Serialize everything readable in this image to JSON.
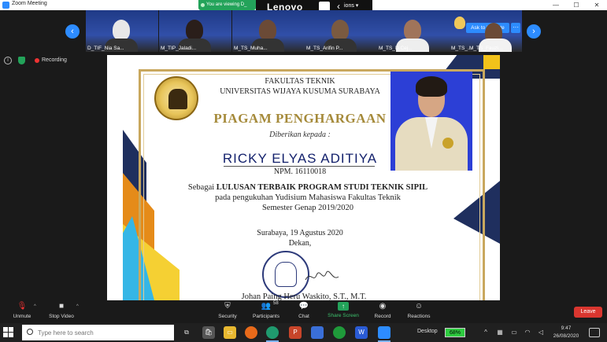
{
  "window": {
    "title": "Zoom Meeting",
    "minimize": "—",
    "maximize": "☐",
    "close": "✕"
  },
  "share_banner": {
    "text": "You are viewing D_",
    "options": "ions ▾"
  },
  "lenovo": {
    "text": "Lenovo",
    "chevron": "‹"
  },
  "gallery": {
    "prev": "‹",
    "next": "›",
    "tiles": [
      {
        "label": "D_TIF_Nia Sa..."
      },
      {
        "label": "M_TIP_Jaladi..."
      },
      {
        "label": "M_TS_Muha..."
      },
      {
        "label": "M_TS_Arifin P..."
      },
      {
        "label": "M_TS_D.Cej..."
      },
      {
        "label": "M_TS_..."
      },
      {
        "label": "M_TS_Fauzi..."
      }
    ],
    "ask_to_unmute": "Ask to Unmute",
    "more": "···"
  },
  "recording": {
    "info": "i",
    "label": "Recording"
  },
  "certificate": {
    "faculty_line1": "FAKULTAS TEKNIK",
    "faculty_line2": "UNIVERSITAS WIJAYA KUSUMA SURABAYA",
    "heading": "PIAGAM PENGHARGAAN",
    "given_to": "Diberikan kepada :",
    "name": "RICKY ELYAS ADITIYA",
    "npm": "NPM. 16110018",
    "statement_prefix": "Sebagai ",
    "statement_bold": "LULUSAN TERBAIK PROGRAM STUDI TEKNIK SIPIL",
    "statement_line2": "pada pengukuhan Yudisium Mahasiswa Fakultas Teknik",
    "statement_line3": "Semester Genap 2019/2020",
    "place_date": "Surabaya, 19 Agustus 2020",
    "dean": "Dekan,",
    "signer": "Johan Paing Heru Waskito, S.T., M.T.",
    "logo_text": "UNIVERSITAS WIJAYA KUSUMA SURABAYA",
    "seal_text": "UNIVERSITAS WIJAYA KUSUMA"
  },
  "toolbar": {
    "unmute": "Unmute",
    "stop_video": "Stop Video",
    "security": "Security",
    "participants": "Participants",
    "participants_count": "58",
    "chat": "Chat",
    "share_screen": "Share Screen",
    "record": "Record",
    "reactions": "Reactions",
    "leave": "Leave"
  },
  "taskbar": {
    "search_placeholder": "Type here to search",
    "desktop": "Desktop",
    "battery": "68%",
    "time": "9:47",
    "date": "26/08/2020"
  },
  "colors": {
    "zoom_blue": "#2d8cff",
    "share_green": "#23a35a",
    "leave_red": "#d9362f",
    "cert_gold": "#c9a85e",
    "cert_navy": "#1f2f5e"
  }
}
